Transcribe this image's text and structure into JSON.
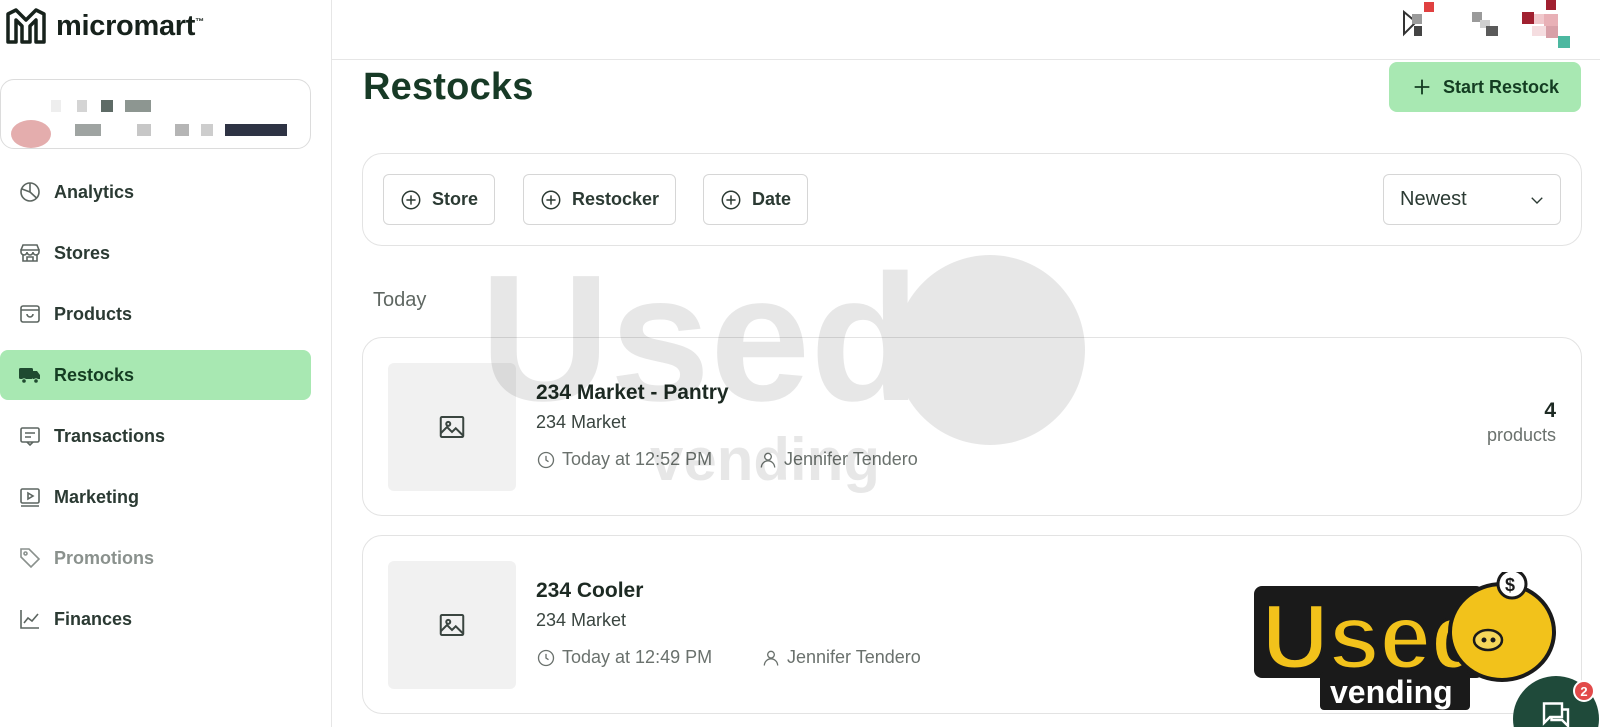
{
  "brand": {
    "name": "micromart",
    "trademark": "™"
  },
  "sidebar": {
    "items": [
      {
        "label": "Analytics",
        "icon": "pie-chart-icon",
        "state": "normal"
      },
      {
        "label": "Stores",
        "icon": "storefront-icon",
        "state": "normal"
      },
      {
        "label": "Products",
        "icon": "product-box-icon",
        "state": "normal"
      },
      {
        "label": "Restocks",
        "icon": "truck-icon",
        "state": "active"
      },
      {
        "label": "Transactions",
        "icon": "receipt-icon",
        "state": "normal"
      },
      {
        "label": "Marketing",
        "icon": "play-screen-icon",
        "state": "normal"
      },
      {
        "label": "Promotions",
        "icon": "tag-icon",
        "state": "muted"
      },
      {
        "label": "Finances",
        "icon": "line-chart-icon",
        "state": "normal"
      }
    ]
  },
  "main": {
    "title": "Restocks",
    "start_button": "Start Restock",
    "filters": [
      {
        "label": "Store"
      },
      {
        "label": "Restocker"
      },
      {
        "label": "Date"
      }
    ],
    "sort": {
      "selected": "Newest"
    },
    "section": "Today",
    "restocks": [
      {
        "title": "234 Market - Pantry",
        "store": "234 Market",
        "time": "Today at 12:52 PM",
        "restocker": "Jennifer Tendero",
        "count": "4",
        "count_label": "products"
      },
      {
        "title": "234 Cooler",
        "store": "234 Market",
        "time": "Today at 12:49 PM",
        "restocker": "Jennifer Tendero"
      }
    ]
  },
  "watermark": {
    "word": "Used",
    "sub": "vending",
    "coin": "$"
  },
  "chat": {
    "badge": "2"
  },
  "colors": {
    "accent": "#a8e8b2",
    "accent_text": "#143d22",
    "heading": "#173a26",
    "watermark_yellow": "#f2c21b"
  }
}
